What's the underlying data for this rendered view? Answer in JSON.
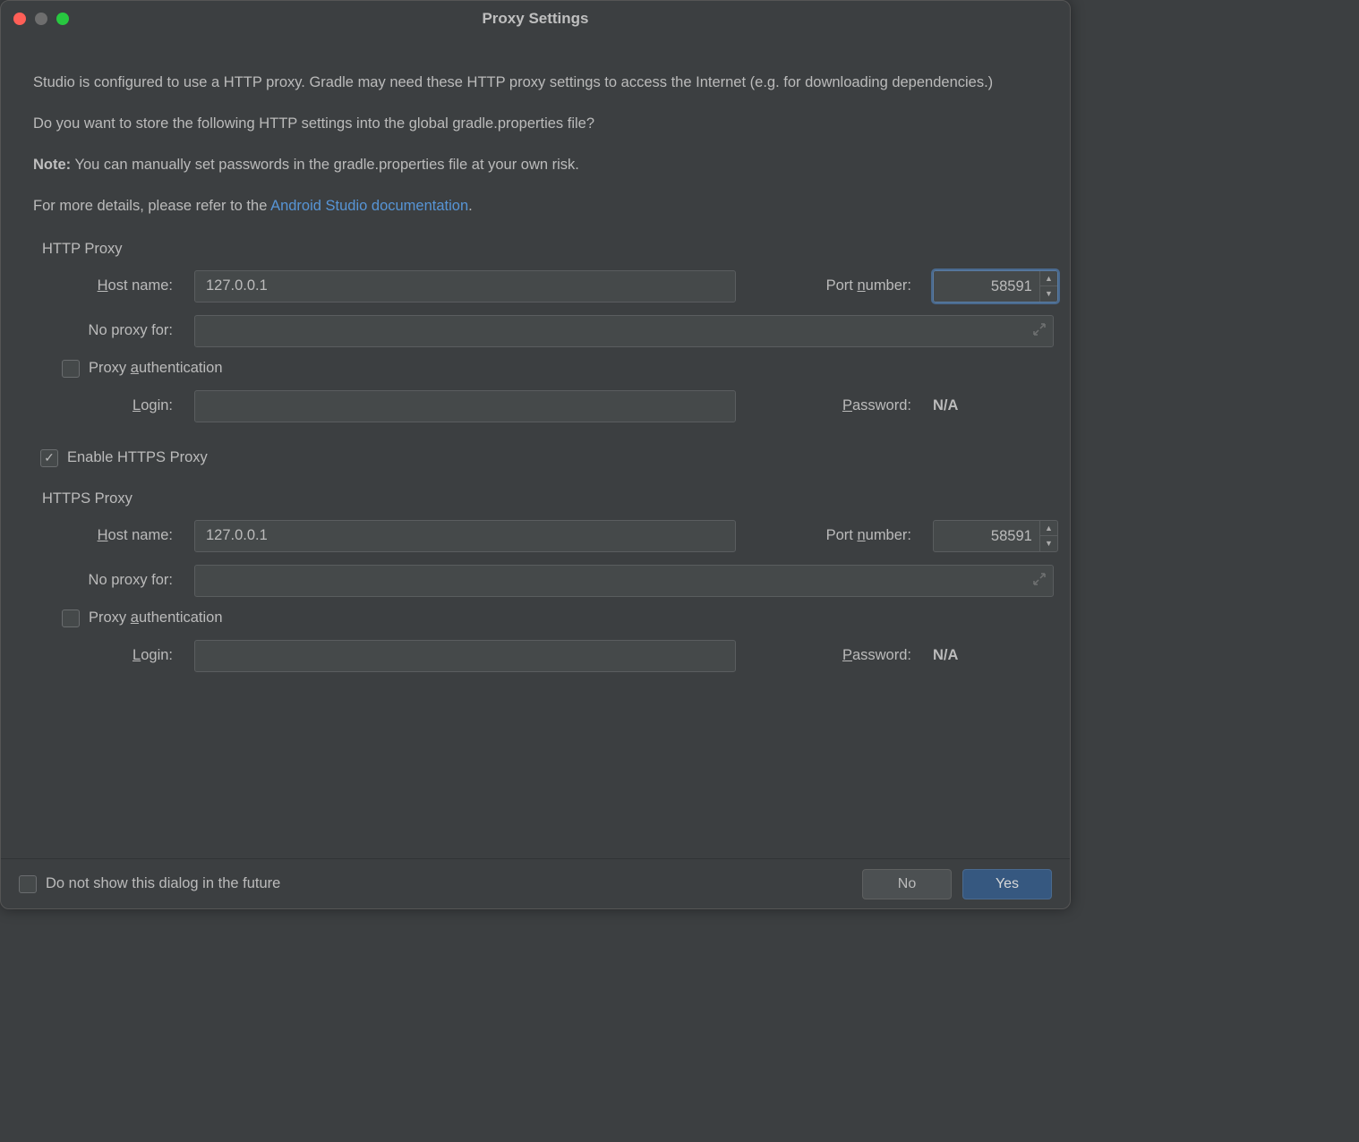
{
  "window": {
    "title": "Proxy Settings"
  },
  "intro": {
    "p1_a": "Studio is configured to use a HTTP proxy. Gradle may need these HTTP proxy settings to access the Internet (e.g. for downloading dependencies.)",
    "p2": "Do you want to store the following HTTP settings into the global gradle.properties file?",
    "note_label": "Note:",
    "note_text": " You can manually set passwords in the gradle.properties file at your own risk.",
    "more_a": "For more details, please refer to the ",
    "more_link": "Android Studio documentation",
    "more_b": "."
  },
  "http": {
    "section": "HTTP Proxy",
    "host_label_u": "H",
    "host_label_r": "ost name:",
    "host_value": "127.0.0.1",
    "port_label_a": "Port ",
    "port_label_u": "n",
    "port_label_b": "umber:",
    "port_value": "58591",
    "noproxy_label": "No proxy for:",
    "noproxy_value": "",
    "auth_label_a": "Proxy ",
    "auth_label_u": "a",
    "auth_label_b": "uthentication",
    "auth_checked": false,
    "login_label_u": "L",
    "login_label_r": "ogin:",
    "login_value": "",
    "pwd_label_u": "P",
    "pwd_label_r": "assword:",
    "pwd_value": "N/A"
  },
  "enable_https": {
    "label": "Enable HTTPS Proxy",
    "checked": true
  },
  "https": {
    "section": "HTTPS Proxy",
    "host_label_u": "H",
    "host_label_r": "ost name:",
    "host_value": "127.0.0.1",
    "port_label_a": "Port ",
    "port_label_u": "n",
    "port_label_b": "umber:",
    "port_value": "58591",
    "noproxy_label": "No proxy for:",
    "noproxy_value": "",
    "auth_label_a": "Proxy ",
    "auth_label_u": "a",
    "auth_label_b": "uthentication",
    "auth_checked": false,
    "login_label_u": "L",
    "login_label_r": "ogin:",
    "login_value": "",
    "pwd_label_u": "P",
    "pwd_label_r": "assword:",
    "pwd_value": "N/A"
  },
  "footer": {
    "dont_show": "Do not show this dialog in the future",
    "dont_show_checked": false,
    "no": "No",
    "yes": "Yes"
  }
}
